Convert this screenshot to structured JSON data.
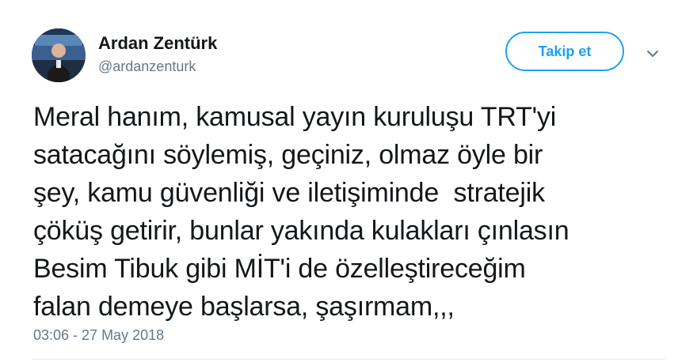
{
  "author": {
    "name": "Ardan Zentürk",
    "handle": "@ardanzenturk",
    "avatar_icon": "profile-photo"
  },
  "actions": {
    "follow_label": "Takip et",
    "more_icon": "chevron-down-icon"
  },
  "tweet": {
    "lines": [
      "Meral hanım, kamusal yayın kuruluşu TRT'yi",
      "satacağını söylemiş, geçiniz, olmaz öyle bir",
      "şey, kamu güvenliği ve iletişiminde  stratejik",
      "çöküş getirir, bunlar yakında kulakları çınlasın",
      "Besim Tibuk gibi MİT'i de özelleştireceğim",
      "falan demeye başlarsa, şaşırmam,,,"
    ],
    "timestamp": "03:06 - 27 May 2018"
  },
  "colors": {
    "accent": "#1da1f2",
    "text": "#14171a",
    "muted": "#657786"
  }
}
